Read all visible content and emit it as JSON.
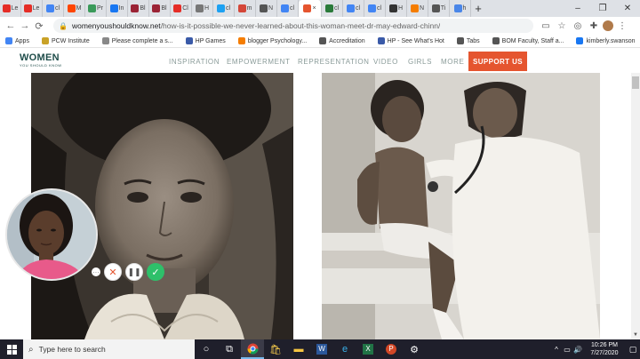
{
  "browser": {
    "tabs": [
      {
        "icon": "youtube",
        "color": "#e52d27",
        "label": "Le"
      },
      {
        "icon": "youtube",
        "color": "#e52d27",
        "label": "Le"
      },
      {
        "icon": "google",
        "color": "#4285f4",
        "label": "cl"
      },
      {
        "icon": "reddit",
        "color": "#ff4500",
        "label": "M"
      },
      {
        "icon": "grid",
        "color": "#3a9a5a",
        "label": "Pr"
      },
      {
        "icon": "facebook",
        "color": "#1877f2",
        "label": "In"
      },
      {
        "icon": "bing",
        "color": "#9b2335",
        "label": "Bl"
      },
      {
        "icon": "bing",
        "color": "#9b2335",
        "label": "Bl"
      },
      {
        "icon": "youtube",
        "color": "#e52d27",
        "label": "Cl"
      },
      {
        "icon": "file",
        "color": "#777777",
        "label": "H"
      },
      {
        "icon": "twitter",
        "color": "#1da1f2",
        "label": "cl"
      },
      {
        "icon": "gmail",
        "color": "#d44638",
        "label": "m"
      },
      {
        "icon": "arrow",
        "color": "#555555",
        "label": "N"
      },
      {
        "icon": "google",
        "color": "#4285f4",
        "label": "cl"
      },
      {
        "icon": "active",
        "color": "#e5552f",
        "label": "×",
        "active": true
      },
      {
        "icon": "va",
        "color": "#2a7a3a",
        "label": "cl"
      },
      {
        "icon": "google",
        "color": "#4285f4",
        "label": "cl"
      },
      {
        "icon": "google",
        "color": "#4285f4",
        "label": "cl"
      },
      {
        "icon": "wx",
        "color": "#333333",
        "label": "H"
      },
      {
        "icon": "blogger",
        "color": "#f57d00",
        "label": "N"
      },
      {
        "icon": "ti",
        "color": "#555555",
        "label": "Ti"
      },
      {
        "icon": "doc",
        "color": "#4a86e8",
        "label": "h"
      }
    ],
    "new_tab": "+",
    "window_controls": {
      "minimize": "–",
      "maximize": "❐",
      "close": "✕"
    },
    "nav": {
      "back": "←",
      "forward": "→",
      "reload": "⟳"
    },
    "url_host": "womenyoushouldknow.net",
    "url_path": "/how-is-it-possible-we-never-learned-about-this-woman-meet-dr-may-edward-chinn/",
    "bookmarks": [
      {
        "label": "Apps",
        "color": "#4285f4"
      },
      {
        "label": "PCW Institute",
        "color": "#c9a227"
      },
      {
        "label": "Please complete a s...",
        "color": "#888888"
      },
      {
        "label": "HP Games",
        "color": "#3a5aa8"
      },
      {
        "label": "blogger Psychology...",
        "color": "#f57d00"
      },
      {
        "label": "Accreditation",
        "color": "#555555"
      },
      {
        "label": "HP - See What's Hot",
        "color": "#3a5aa8"
      },
      {
        "label": "Tabs",
        "color": "#555555"
      },
      {
        "label": "BOM Faculty, Staff a...",
        "color": "#555555"
      },
      {
        "label": "kimberly.swanson",
        "color": "#1877f2"
      }
    ]
  },
  "site": {
    "logo_big": "WOMEN",
    "logo_small": "YOU SHOULD KNOW",
    "nav": [
      "INSPIRATION",
      "EMPOWERMENT",
      "REPRESENTATION",
      "VIDEO",
      "GIRLS",
      "MORE"
    ],
    "support": "SUPPORT US"
  },
  "taskbar": {
    "search_placeholder": "Type here to search",
    "time": "10:26 PM",
    "date": "7/27/2020"
  }
}
